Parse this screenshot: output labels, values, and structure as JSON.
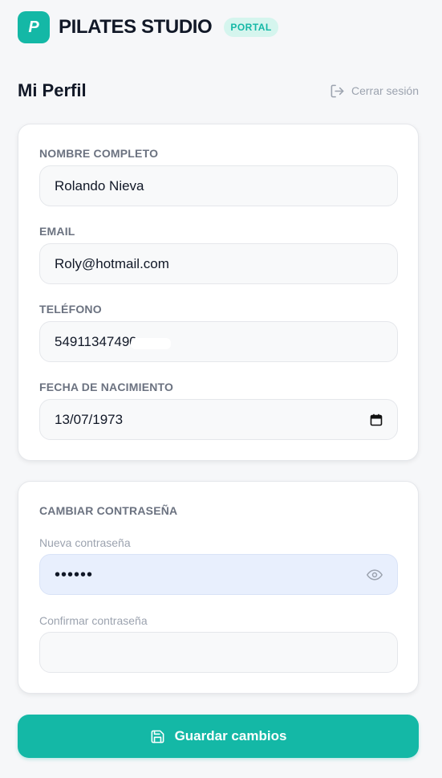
{
  "header": {
    "logo_letter": "P",
    "brand_name": "PILATES STUDIO",
    "badge": "PORTAL"
  },
  "page": {
    "title": "Mi Perfil",
    "logout_label": "Cerrar sesión"
  },
  "profile": {
    "name_label": "NOMBRE COMPLETO",
    "name_value": "Rolando Nieva",
    "email_label": "EMAIL",
    "email_value": "Roly@hotmail.com",
    "phone_label": "TELÉFONO",
    "phone_value": "54911347490",
    "birth_label": "FECHA DE NACIMIENTO",
    "birth_value": "13/07/1973"
  },
  "password": {
    "section_label": "CAMBIAR CONTRASEÑA",
    "new_label": "Nueva contraseña",
    "new_value": "••••••",
    "confirm_label": "Confirmar contraseña",
    "confirm_value": ""
  },
  "actions": {
    "save_label": "Guardar cambios"
  },
  "colors": {
    "accent": "#14b8a6",
    "badge_bg": "#d5f5ee",
    "autofill_bg": "#e8effd"
  }
}
